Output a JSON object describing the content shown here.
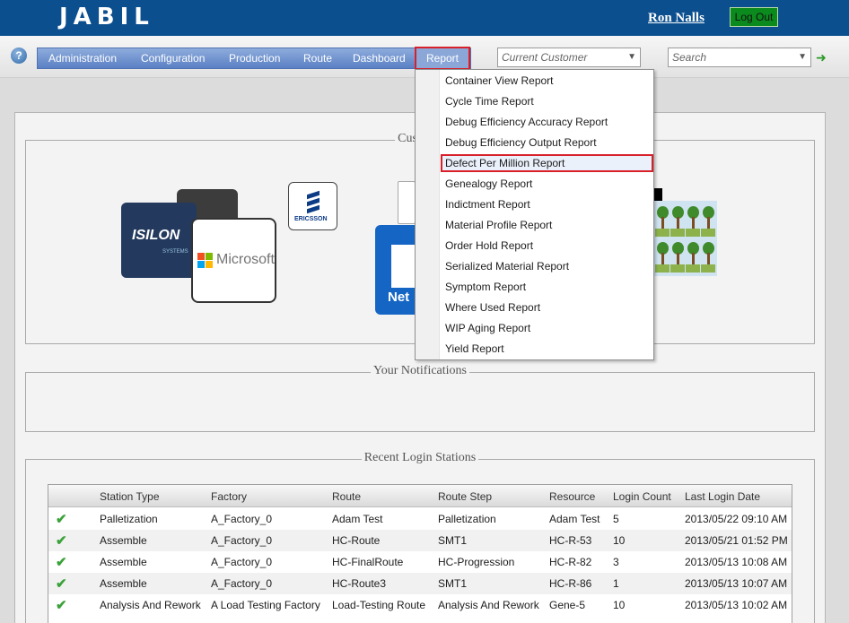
{
  "header": {
    "logo_text": "JABIL",
    "user_name": "Ron Nalls",
    "logout_label": "Log Out"
  },
  "nav": {
    "menu": [
      {
        "label": "Administration"
      },
      {
        "label": "Configuration"
      },
      {
        "label": "Production"
      },
      {
        "label": "Route"
      },
      {
        "label": "Dashboard"
      },
      {
        "label": "Report",
        "active": true
      }
    ],
    "customer_select": {
      "value": "Current Customer"
    },
    "search_select": {
      "value": "Search"
    }
  },
  "report_menu": {
    "items": [
      "Container View Report",
      "Cycle Time Report",
      "Debug Efficiency Accuracy Report",
      "Debug Efficiency Output Report",
      "Defect Per Million Report",
      "Genealogy Report",
      "Indictment Report",
      "Material Profile Report",
      "Order Hold Report",
      "Serialized Material Report",
      "Symptom Report",
      "Where Used Report",
      "WIP Aging Report",
      "Yield Report"
    ],
    "highlighted_index": 4
  },
  "sections": {
    "customers_title": "Custome",
    "notifications_title": "Your Notifications",
    "stations_title": "Recent Login Stations"
  },
  "customer_logos": {
    "isilon_text": "ISILON",
    "isilon_sub": "SYSTEMS",
    "microsoft_text": "Microsoft",
    "ericsson_text": "ERICSSON",
    "net_text": "Net"
  },
  "stations": {
    "columns": [
      "Station Type",
      "Factory",
      "Route",
      "Route Step",
      "Resource",
      "Login Count",
      "Last Login Date"
    ],
    "rows": [
      [
        "Palletization",
        "A_Factory_0",
        "Adam Test",
        "Palletization",
        "Adam Test",
        "5",
        "2013/05/22 09:10 AM"
      ],
      [
        "Assemble",
        "A_Factory_0",
        "HC-Route",
        "SMT1",
        "HC-R-53",
        "10",
        "2013/05/21 01:52 PM"
      ],
      [
        "Assemble",
        "A_Factory_0",
        "HC-FinalRoute",
        "HC-Progression",
        "HC-R-82",
        "3",
        "2013/05/13 10:08 AM"
      ],
      [
        "Assemble",
        "A_Factory_0",
        "HC-Route3",
        "SMT1",
        "HC-R-86",
        "1",
        "2013/05/13 10:07 AM"
      ],
      [
        "Analysis And Rework",
        "A Load Testing Factory",
        "Load-Testing Route",
        "Analysis And Rework",
        "Gene-5",
        "10",
        "2013/05/13 10:02 AM"
      ]
    ]
  },
  "colors": {
    "header_bg": "#0c4f8f",
    "menu_bg": "#6a8cc8",
    "highlight": "#d8202a",
    "check": "#3ba23a"
  }
}
